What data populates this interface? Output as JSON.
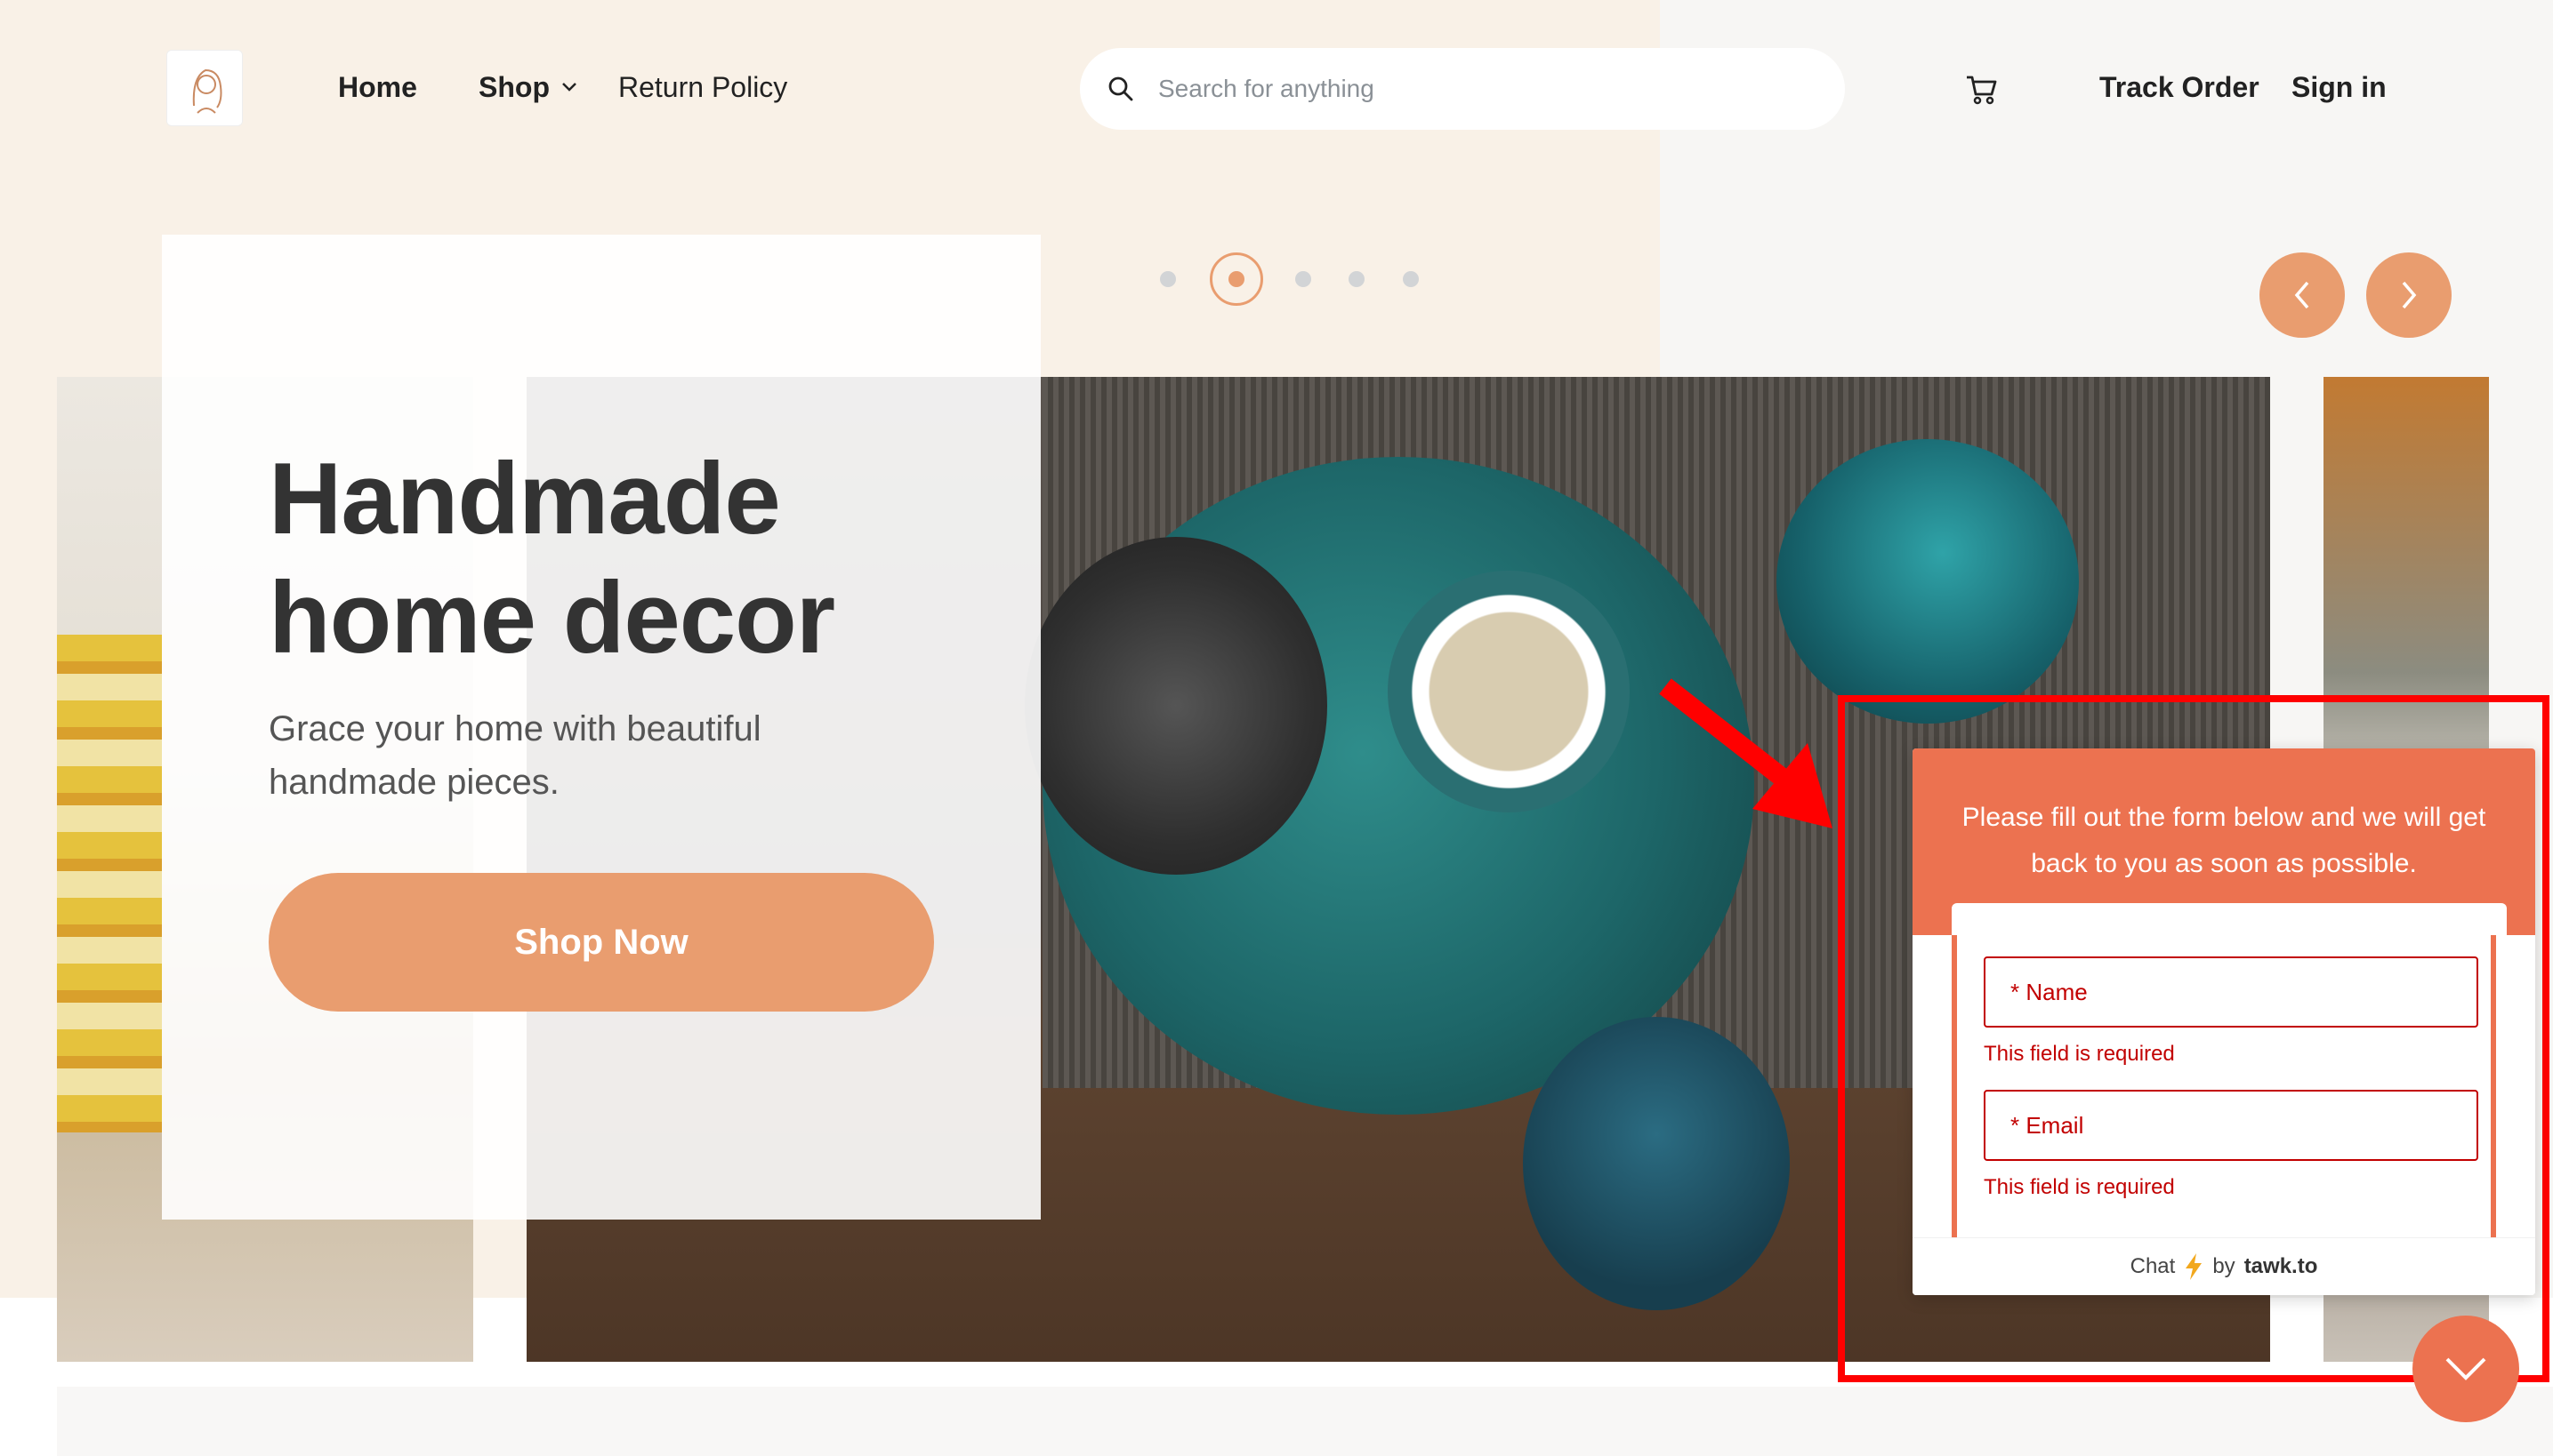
{
  "header": {
    "logo_icon": "brand-logo-icon",
    "nav": {
      "home": "Home",
      "shop": "Shop",
      "return_policy": "Return Policy",
      "track_order": "Track Order",
      "sign_in": "Sign in"
    },
    "search": {
      "placeholder": "Search for anything",
      "value": ""
    },
    "cart_icon": "cart-icon"
  },
  "hero": {
    "title": "Handmade home decor",
    "subtitle": "Grace your home with beautiful handmade pieces.",
    "cta": "Shop Now"
  },
  "carousel": {
    "slide_count": 5,
    "active_slide": 2,
    "prev_icon": "chevron-left-icon",
    "next_icon": "chevron-right-icon"
  },
  "chat_widget": {
    "header_text": "Please fill out the form below and we will get back to you as soon as possible.",
    "name_field": {
      "label": "* Name",
      "error": "This field is required"
    },
    "email_field": {
      "label": "* Email",
      "error": "This field is required"
    },
    "footer_chat": "Chat",
    "footer_by": "by",
    "footer_brand": "tawk.to",
    "minimize_icon": "chevron-down-icon"
  },
  "colors": {
    "accent": "#e99d6f",
    "chat_accent": "#ec7250",
    "error": "#c20000",
    "annotation": "#ff0000",
    "cream_bg": "#f9f1e7"
  }
}
